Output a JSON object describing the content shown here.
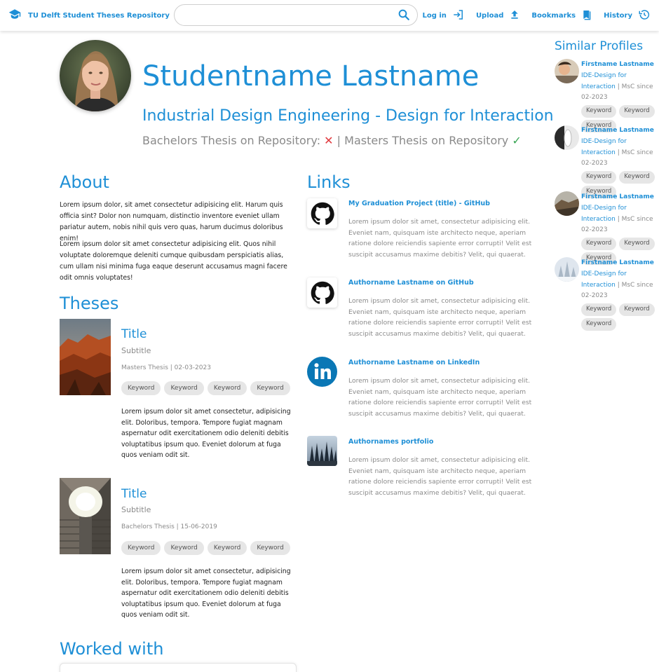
{
  "header": {
    "brand": "TU Delft Student Theses Repository",
    "search_value": "",
    "nav": {
      "login": "Log in",
      "upload": "Upload",
      "bookmarks": "Bookmarks",
      "history": "History"
    }
  },
  "profile": {
    "name": "Studentname Lastname",
    "program": "Industrial Design Engineering - Design for Interaction",
    "bachelor_label": "Bachelors Thesis on Repository:",
    "bachelor_mark": "✕",
    "separator": "|",
    "masters_label": "Masters Thesis on Repository",
    "masters_mark": "✓"
  },
  "about": {
    "heading": "About",
    "paragraphs": [
      "Lorem ipsum dolor, sit amet consectetur adipisicing elit. Harum quis officia sint? Dolor non numquam, distinctio inventore eveniet ullam pariatur autem, nobis nihil quis vero quas, harum ducimus doloribus enim!",
      "Lorem ipsum dolor sit amet consectetur adipisicing elit. Quos nihil voluptate doloremque deleniti cumque quibusdam perspiciatis alias, cum ullam nisi minima fuga eaque deserunt accusamus magni facere odit omnis voluptates!"
    ]
  },
  "theses": {
    "heading": "Theses",
    "items": [
      {
        "title": "Title",
        "subtitle": "Subtitle",
        "meta": "Masters Thesis | 02-03-2023",
        "keywords": [
          "Keyword",
          "Keyword",
          "Keyword",
          "Keyword"
        ],
        "description": "Lorem ipsum dolor sit amet consectetur, adipisicing elit. Doloribus, tempora. Tempore fugiat magnam aspernatur odit exercitationem odio deleniti debitis voluptatibus ipsum quo. Eveniet dolorum at fuga quos veniam odit sit."
      },
      {
        "title": "Title",
        "subtitle": "Subtitle",
        "meta": "Bachelors Thesis | 15-06-2019",
        "keywords": [
          "Keyword",
          "Keyword",
          "Keyword",
          "Keyword"
        ],
        "description": "Lorem ipsum dolor sit amet consectetur, adipisicing elit. Doloribus, tempora. Tempore fugiat magnam aspernatur odit exercitationem odio deleniti debitis voluptatibus ipsum quo. Eveniet dolorum at fuga quos veniam odit sit."
      }
    ]
  },
  "links": {
    "heading": "Links",
    "items": [
      {
        "icon": "github-icon",
        "title": "My Graduation Project (title) - GitHub",
        "description": "Lorem ipsum dolor sit amet, consectetur adipisicing elit. Eveniet nam, quisquam iste architecto neque, aperiam ratione dolore reiciendis sapiente error corrupti! Velit est suscipit accusamus maxime debitis? Velit, qui quaerat."
      },
      {
        "icon": "github-icon",
        "title": "Authorname Lastname on GitHub",
        "description": "Lorem ipsum dolor sit amet, consectetur adipisicing elit. Eveniet nam, quisquam iste architecto neque, aperiam ratione dolore reiciendis sapiente error corrupti! Velit est suscipit accusamus maxime debitis? Velit, qui quaerat."
      },
      {
        "icon": "linkedin-icon",
        "title": "Authorname Lastname on LinkedIn",
        "description": "Lorem ipsum dolor sit amet, consectetur adipisicing elit. Eveniet nam, quisquam iste architecto neque, aperiam ratione dolore reiciendis sapiente error corrupti! Velit est suscipit accusamus maxime debitis? Velit, qui quaerat."
      },
      {
        "icon": "portfolio-thumbnail",
        "title": "Authornames portfolio",
        "description": "Lorem ipsum dolor sit amet, consectetur adipisicing elit. Eveniet nam, quisquam iste architecto neque, aperiam ratione dolore reiciendis sapiente error corrupti! Velit est suscipit accusamus maxime debitis? Velit, qui quaerat."
      }
    ]
  },
  "worked_with": {
    "heading": "Worked with"
  },
  "similar": {
    "heading": "Similar Profiles",
    "items": [
      {
        "name": "Firstname Lastname",
        "program": "IDE-Design for Interaction",
        "since": "| MsC since 02-2023",
        "keywords": [
          "Keyword",
          "Keyword",
          "Keyword"
        ]
      },
      {
        "name": "Firstname Lastname",
        "program": "IDE-Design for Interaction",
        "since": "| MsC since 02-2023",
        "keywords": [
          "Keyword",
          "Keyword",
          "Keyword"
        ]
      },
      {
        "name": "Firstname Lastname",
        "program": "IDE-Design for Interaction",
        "since": "| MsC since 02-2023",
        "keywords": [
          "Keyword",
          "Keyword",
          "Keyword"
        ]
      },
      {
        "name": "Firstname Lastname",
        "program": "IDE-Design for Interaction",
        "since": "| MsC since 02-2023",
        "keywords": [
          "Keyword",
          "Keyword",
          "Keyword"
        ]
      }
    ]
  },
  "colors": {
    "accent": "#1e8fd6",
    "muted": "#8a8a8a",
    "chip": "#e6e6e6",
    "error": "#e0393e",
    "success": "#3aa655"
  }
}
